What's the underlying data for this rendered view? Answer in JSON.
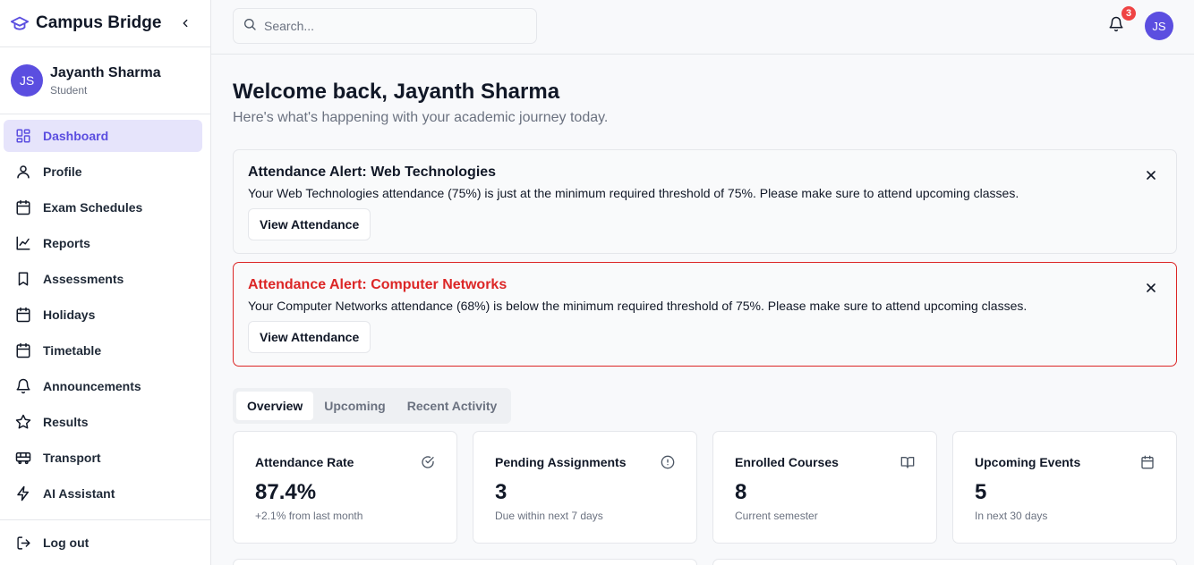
{
  "brand": {
    "name": "Campus Bridge"
  },
  "user": {
    "initials": "JS",
    "name": "Jayanth Sharma",
    "role": "Student"
  },
  "nav": [
    {
      "label": "Dashboard",
      "icon": "dashboard-icon",
      "active": true
    },
    {
      "label": "Profile",
      "icon": "user-icon"
    },
    {
      "label": "Exam Schedules",
      "icon": "calendar-icon"
    },
    {
      "label": "Reports",
      "icon": "line-chart-icon"
    },
    {
      "label": "Assessments",
      "icon": "bookmark-icon"
    },
    {
      "label": "Holidays",
      "icon": "calendar-icon"
    },
    {
      "label": "Timetable",
      "icon": "calendar-icon"
    },
    {
      "label": "Announcements",
      "icon": "bell-icon"
    },
    {
      "label": "Results",
      "icon": "star-icon"
    },
    {
      "label": "Transport",
      "icon": "bus-icon"
    },
    {
      "label": "AI Assistant",
      "icon": "zap-icon"
    }
  ],
  "logout": {
    "label": "Log out"
  },
  "header": {
    "search_placeholder": "Search...",
    "notification_count": "3",
    "avatar_initials": "JS"
  },
  "main": {
    "welcome": "Welcome back, Jayanth Sharma",
    "subtitle": "Here's what's happening with your academic journey today.",
    "alerts": [
      {
        "title": "Attendance Alert: Web Technologies",
        "message": "Your Web Technologies attendance (75%) is just at the minimum required threshold of 75%. Please make sure to attend upcoming classes.",
        "button": "View Attendance"
      },
      {
        "title": "Attendance Alert: Computer Networks",
        "message": "Your Computer Networks attendance (68%) is below the minimum required threshold of 75%. Please make sure to attend upcoming classes.",
        "button": "View Attendance"
      }
    ],
    "tabs": [
      "Overview",
      "Upcoming",
      "Recent Activity"
    ],
    "cards": [
      {
        "label": "Attendance Rate",
        "value": "87.4%",
        "sub": "+2.1% from last month",
        "icon": "check-circle-icon"
      },
      {
        "label": "Pending Assignments",
        "value": "3",
        "sub": "Due within next 7 days",
        "icon": "alert-circle-icon"
      },
      {
        "label": "Enrolled Courses",
        "value": "8",
        "sub": "Current semester",
        "icon": "book-open-icon"
      },
      {
        "label": "Upcoming Events",
        "value": "5",
        "sub": "In next 30 days",
        "icon": "calendar-icon"
      }
    ]
  },
  "colors": {
    "accent": "#5b4ee0",
    "accent_bg": "#e6e4fb",
    "danger": "#dc2626",
    "badge": "#ef4444"
  }
}
